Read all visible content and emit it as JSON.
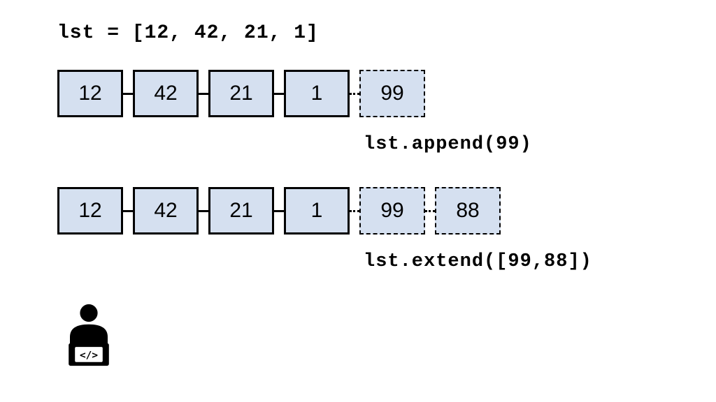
{
  "title": "lst = [12, 42, 21, 1]",
  "row_append": {
    "base": [
      "12",
      "42",
      "21",
      "1"
    ],
    "added": [
      "99"
    ],
    "caption": "lst.append(99)"
  },
  "row_extend": {
    "base": [
      "12",
      "42",
      "21",
      "1"
    ],
    "added": [
      "99",
      "88"
    ],
    "caption": "lst.extend([99,88])"
  },
  "colors": {
    "cell_fill": "#d5e0f0",
    "border": "#000000"
  }
}
